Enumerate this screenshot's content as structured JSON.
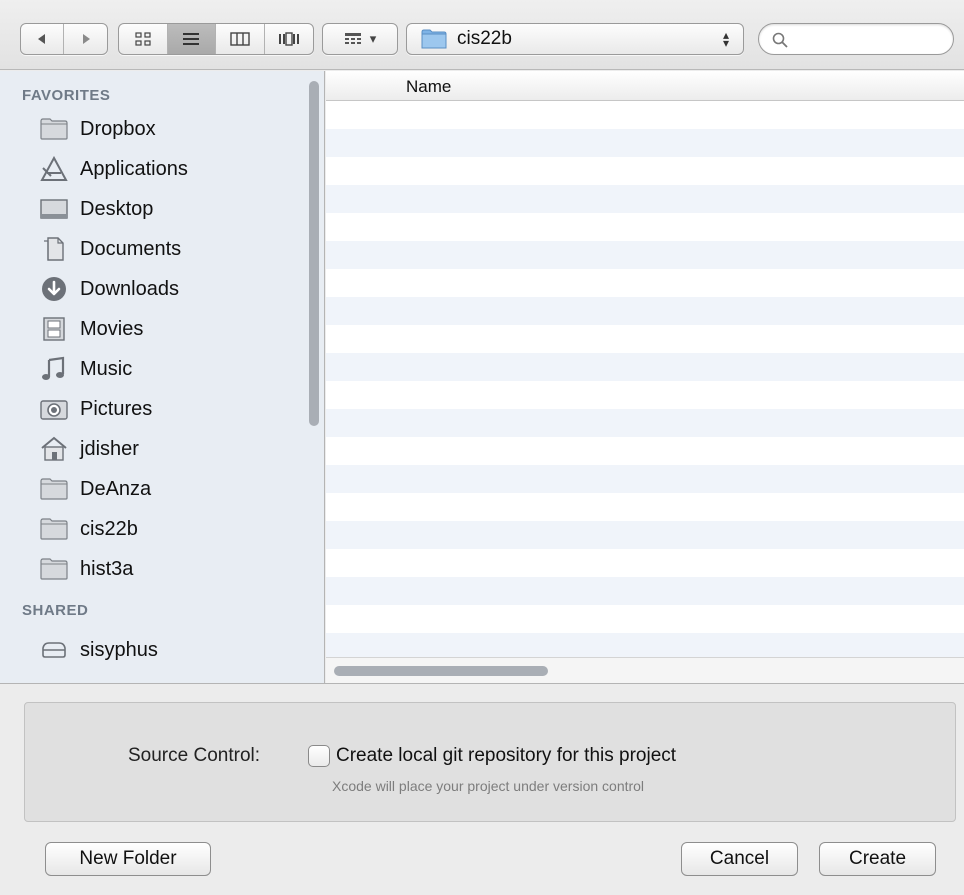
{
  "toolbar": {
    "nav": [
      {
        "icon": "back-arrow-icon",
        "glyph": "◀"
      },
      {
        "icon": "forward-arrow-icon",
        "glyph": "▶"
      }
    ],
    "views": [
      {
        "icon": "icon-view-icon",
        "active": false
      },
      {
        "icon": "list-view-icon",
        "active": true
      },
      {
        "icon": "column-view-icon",
        "active": false
      },
      {
        "icon": "coverflow-view-icon",
        "active": false
      }
    ],
    "arrange": {
      "icon": "arrange-grid-icon",
      "dropdown_glyph": "▾"
    },
    "path_popup": {
      "label": "cis22b",
      "icon": "folder-icon"
    },
    "search": {
      "placeholder": "",
      "value": ""
    }
  },
  "sidebar": {
    "favorites_header": "FAVORITES",
    "favorites": [
      {
        "label": "Dropbox",
        "icon": "folder-icon"
      },
      {
        "label": "Applications",
        "icon": "applications-icon"
      },
      {
        "label": "Desktop",
        "icon": "desktop-icon"
      },
      {
        "label": "Documents",
        "icon": "documents-icon"
      },
      {
        "label": "Downloads",
        "icon": "downloads-icon"
      },
      {
        "label": "Movies",
        "icon": "movies-icon"
      },
      {
        "label": "Music",
        "icon": "music-icon"
      },
      {
        "label": "Pictures",
        "icon": "pictures-icon"
      },
      {
        "label": "jdisher",
        "icon": "home-icon"
      },
      {
        "label": "DeAnza",
        "icon": "folder-icon"
      },
      {
        "label": "cis22b",
        "icon": "folder-icon"
      },
      {
        "label": "hist3a",
        "icon": "folder-icon"
      }
    ],
    "shared_header": "SHARED",
    "shared": [
      {
        "label": "sisyphus",
        "icon": "network-drive-icon"
      }
    ]
  },
  "filelist": {
    "column_name": "Name",
    "rows": []
  },
  "accessory": {
    "source_control_label": "Source Control:",
    "checkbox_label": "Create local git repository for this project",
    "checkbox_checked": false,
    "hint": "Xcode will place your project under version control"
  },
  "buttons": {
    "new_folder": "New Folder",
    "cancel": "Cancel",
    "create": "Create"
  },
  "colors": {
    "sidebar_bg": "#e8edf3",
    "sidebar_header": "#6f7a87",
    "row_stripe": "#f0f4fa",
    "folder_blue": "#8fb8e0"
  }
}
